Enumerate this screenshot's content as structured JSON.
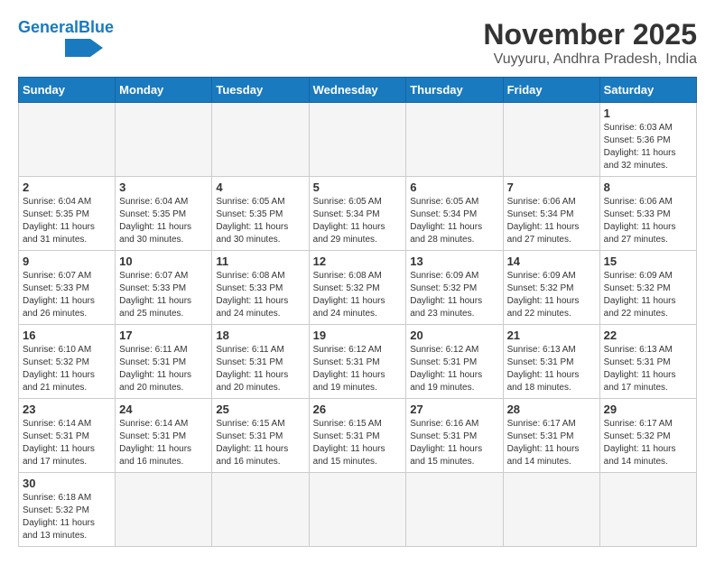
{
  "header": {
    "logo_general": "General",
    "logo_blue": "Blue",
    "month": "November 2025",
    "location": "Vuyyuru, Andhra Pradesh, India"
  },
  "days_of_week": [
    "Sunday",
    "Monday",
    "Tuesday",
    "Wednesday",
    "Thursday",
    "Friday",
    "Saturday"
  ],
  "weeks": [
    [
      {
        "day": "",
        "info": "",
        "empty": true
      },
      {
        "day": "",
        "info": "",
        "empty": true
      },
      {
        "day": "",
        "info": "",
        "empty": true
      },
      {
        "day": "",
        "info": "",
        "empty": true
      },
      {
        "day": "",
        "info": "",
        "empty": true
      },
      {
        "day": "",
        "info": "",
        "empty": true
      },
      {
        "day": "1",
        "info": "Sunrise: 6:03 AM\nSunset: 5:36 PM\nDaylight: 11 hours\nand 32 minutes.",
        "empty": false
      }
    ],
    [
      {
        "day": "2",
        "info": "Sunrise: 6:04 AM\nSunset: 5:35 PM\nDaylight: 11 hours\nand 31 minutes.",
        "empty": false
      },
      {
        "day": "3",
        "info": "Sunrise: 6:04 AM\nSunset: 5:35 PM\nDaylight: 11 hours\nand 30 minutes.",
        "empty": false
      },
      {
        "day": "4",
        "info": "Sunrise: 6:05 AM\nSunset: 5:35 PM\nDaylight: 11 hours\nand 30 minutes.",
        "empty": false
      },
      {
        "day": "5",
        "info": "Sunrise: 6:05 AM\nSunset: 5:34 PM\nDaylight: 11 hours\nand 29 minutes.",
        "empty": false
      },
      {
        "day": "6",
        "info": "Sunrise: 6:05 AM\nSunset: 5:34 PM\nDaylight: 11 hours\nand 28 minutes.",
        "empty": false
      },
      {
        "day": "7",
        "info": "Sunrise: 6:06 AM\nSunset: 5:34 PM\nDaylight: 11 hours\nand 27 minutes.",
        "empty": false
      },
      {
        "day": "8",
        "info": "Sunrise: 6:06 AM\nSunset: 5:33 PM\nDaylight: 11 hours\nand 27 minutes.",
        "empty": false
      }
    ],
    [
      {
        "day": "9",
        "info": "Sunrise: 6:07 AM\nSunset: 5:33 PM\nDaylight: 11 hours\nand 26 minutes.",
        "empty": false
      },
      {
        "day": "10",
        "info": "Sunrise: 6:07 AM\nSunset: 5:33 PM\nDaylight: 11 hours\nand 25 minutes.",
        "empty": false
      },
      {
        "day": "11",
        "info": "Sunrise: 6:08 AM\nSunset: 5:33 PM\nDaylight: 11 hours\nand 24 minutes.",
        "empty": false
      },
      {
        "day": "12",
        "info": "Sunrise: 6:08 AM\nSunset: 5:32 PM\nDaylight: 11 hours\nand 24 minutes.",
        "empty": false
      },
      {
        "day": "13",
        "info": "Sunrise: 6:09 AM\nSunset: 5:32 PM\nDaylight: 11 hours\nand 23 minutes.",
        "empty": false
      },
      {
        "day": "14",
        "info": "Sunrise: 6:09 AM\nSunset: 5:32 PM\nDaylight: 11 hours\nand 22 minutes.",
        "empty": false
      },
      {
        "day": "15",
        "info": "Sunrise: 6:09 AM\nSunset: 5:32 PM\nDaylight: 11 hours\nand 22 minutes.",
        "empty": false
      }
    ],
    [
      {
        "day": "16",
        "info": "Sunrise: 6:10 AM\nSunset: 5:32 PM\nDaylight: 11 hours\nand 21 minutes.",
        "empty": false
      },
      {
        "day": "17",
        "info": "Sunrise: 6:11 AM\nSunset: 5:31 PM\nDaylight: 11 hours\nand 20 minutes.",
        "empty": false
      },
      {
        "day": "18",
        "info": "Sunrise: 6:11 AM\nSunset: 5:31 PM\nDaylight: 11 hours\nand 20 minutes.",
        "empty": false
      },
      {
        "day": "19",
        "info": "Sunrise: 6:12 AM\nSunset: 5:31 PM\nDaylight: 11 hours\nand 19 minutes.",
        "empty": false
      },
      {
        "day": "20",
        "info": "Sunrise: 6:12 AM\nSunset: 5:31 PM\nDaylight: 11 hours\nand 19 minutes.",
        "empty": false
      },
      {
        "day": "21",
        "info": "Sunrise: 6:13 AM\nSunset: 5:31 PM\nDaylight: 11 hours\nand 18 minutes.",
        "empty": false
      },
      {
        "day": "22",
        "info": "Sunrise: 6:13 AM\nSunset: 5:31 PM\nDaylight: 11 hours\nand 17 minutes.",
        "empty": false
      }
    ],
    [
      {
        "day": "23",
        "info": "Sunrise: 6:14 AM\nSunset: 5:31 PM\nDaylight: 11 hours\nand 17 minutes.",
        "empty": false
      },
      {
        "day": "24",
        "info": "Sunrise: 6:14 AM\nSunset: 5:31 PM\nDaylight: 11 hours\nand 16 minutes.",
        "empty": false
      },
      {
        "day": "25",
        "info": "Sunrise: 6:15 AM\nSunset: 5:31 PM\nDaylight: 11 hours\nand 16 minutes.",
        "empty": false
      },
      {
        "day": "26",
        "info": "Sunrise: 6:15 AM\nSunset: 5:31 PM\nDaylight: 11 hours\nand 15 minutes.",
        "empty": false
      },
      {
        "day": "27",
        "info": "Sunrise: 6:16 AM\nSunset: 5:31 PM\nDaylight: 11 hours\nand 15 minutes.",
        "empty": false
      },
      {
        "day": "28",
        "info": "Sunrise: 6:17 AM\nSunset: 5:31 PM\nDaylight: 11 hours\nand 14 minutes.",
        "empty": false
      },
      {
        "day": "29",
        "info": "Sunrise: 6:17 AM\nSunset: 5:32 PM\nDaylight: 11 hours\nand 14 minutes.",
        "empty": false
      }
    ],
    [
      {
        "day": "30",
        "info": "Sunrise: 6:18 AM\nSunset: 5:32 PM\nDaylight: 11 hours\nand 13 minutes.",
        "empty": false
      },
      {
        "day": "",
        "info": "",
        "empty": true
      },
      {
        "day": "",
        "info": "",
        "empty": true
      },
      {
        "day": "",
        "info": "",
        "empty": true
      },
      {
        "day": "",
        "info": "",
        "empty": true
      },
      {
        "day": "",
        "info": "",
        "empty": true
      },
      {
        "day": "",
        "info": "",
        "empty": true
      }
    ]
  ]
}
